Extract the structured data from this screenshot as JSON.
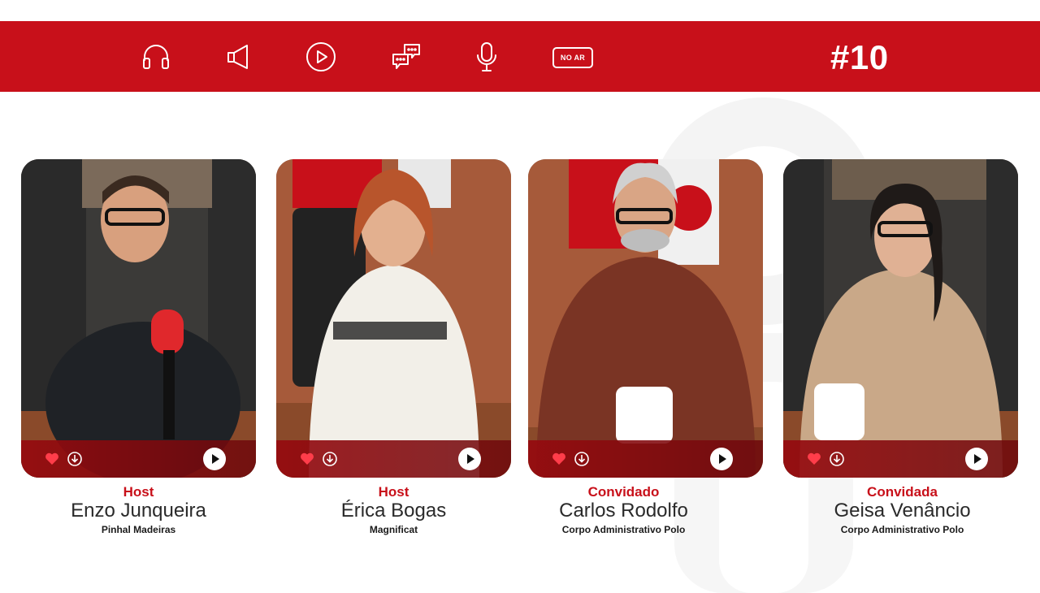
{
  "header": {
    "icons": [
      "headphones-icon",
      "megaphone-icon",
      "play-circle-icon",
      "chat-bubbles-icon",
      "microphone-icon"
    ],
    "live_badge": "NO AR",
    "episode": "#10",
    "colors": {
      "brand_red": "#c8101a",
      "text_dark": "#2a2a2a"
    }
  },
  "cards": [
    {
      "role": "Host",
      "name": "Enzo Junqueira",
      "org": "Pinhal Madeiras"
    },
    {
      "role": "Host",
      "name": "Érica Bogas",
      "org": "Magnificat"
    },
    {
      "role": "Convidado",
      "name": "Carlos Rodolfo",
      "org": "Corpo Administrativo Polo"
    },
    {
      "role": "Convidada",
      "name": "Geisa Venâncio",
      "org": "Corpo Administrativo Polo"
    }
  ],
  "card_controls": [
    "heart-icon",
    "download-icon",
    "play-icon"
  ]
}
